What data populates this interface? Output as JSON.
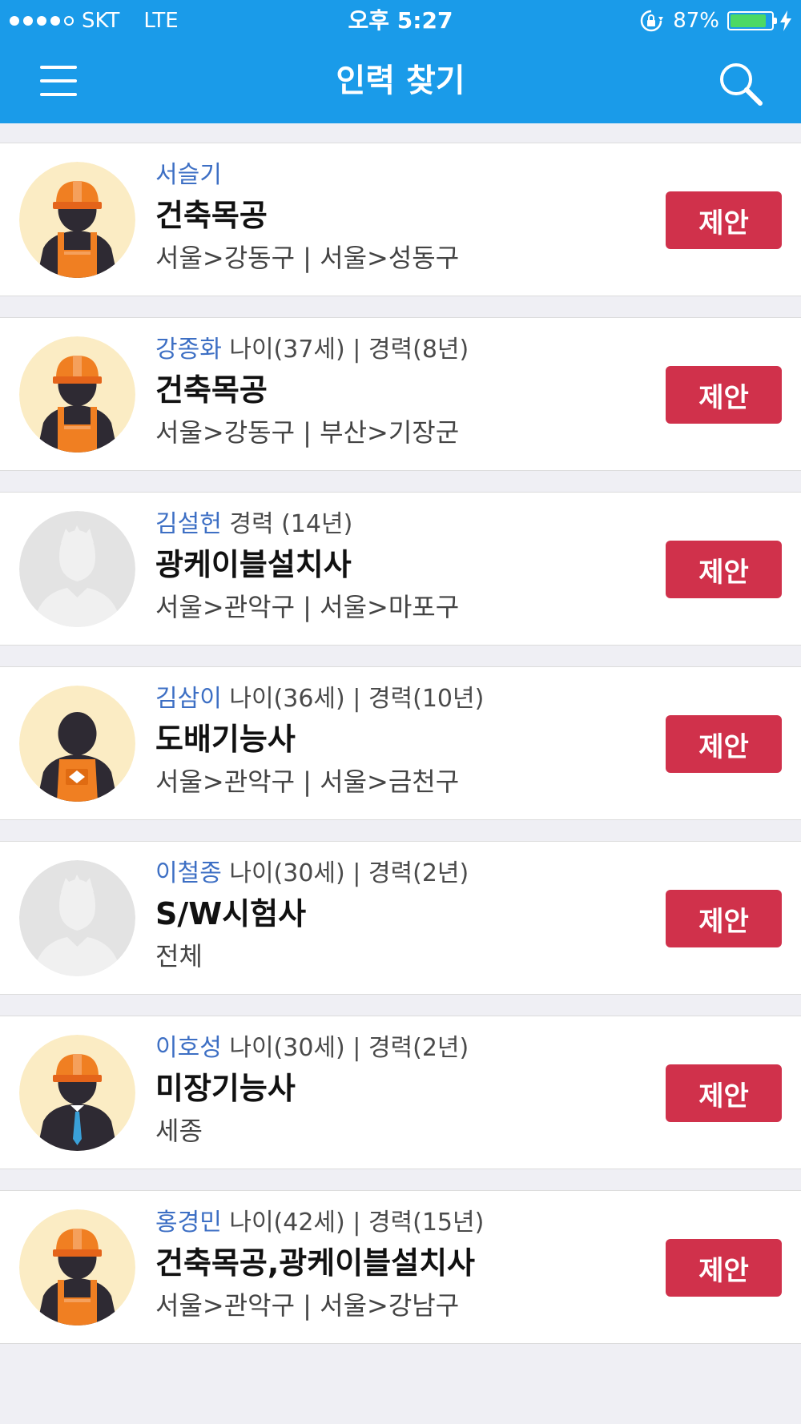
{
  "status_bar": {
    "carrier": "SKT",
    "network": "LTE",
    "time": "오후 5:27",
    "battery": "87%",
    "battery_level": 0.87
  },
  "header": {
    "title": "인력 찾기",
    "menu_icon": "hamburger-menu-icon",
    "search_icon": "search-icon"
  },
  "workers": [
    {
      "name": "서슬기",
      "meta": "",
      "job": "건축목공",
      "region": "서울>강동구 | 서울>성동구",
      "avatar": "worker-helmet",
      "button": "제안"
    },
    {
      "name": "강종화",
      "meta": " 나이(37세) | 경력(8년)",
      "job": "건축목공",
      "region": "서울>강동구 | 부산>기장군",
      "avatar": "worker-helmet",
      "button": "제안"
    },
    {
      "name": "김설헌",
      "meta": " 경력 (14년)",
      "job": "광케이블설치사",
      "region": "서울>관악구 | 서울>마포구",
      "avatar": "placeholder",
      "button": "제안"
    },
    {
      "name": "김삼이",
      "meta": " 나이(36세) | 경력(10년)",
      "job": "도배기능사",
      "region": "서울>관악구 | 서울>금천구",
      "avatar": "worker-apron",
      "button": "제안"
    },
    {
      "name": "이철종",
      "meta": " 나이(30세) | 경력(2년)",
      "job": "S/W시험사",
      "region": "전체",
      "avatar": "placeholder",
      "button": "제안"
    },
    {
      "name": "이호성",
      "meta": " 나이(30세) | 경력(2년)",
      "job": "미장기능사",
      "region": "세종",
      "avatar": "worker-tie",
      "button": "제안"
    },
    {
      "name": "홍경민",
      "meta": " 나이(42세) | 경력(15년)",
      "job": "건축목공,광케이블설치사",
      "region": "서울>관악구 | 서울>강남구",
      "avatar": "worker-helmet",
      "button": "제안"
    }
  ],
  "colors": {
    "header": "#1a9be9",
    "name": "#3d6fc4",
    "button": "#d0314b",
    "background": "#efeff4"
  }
}
